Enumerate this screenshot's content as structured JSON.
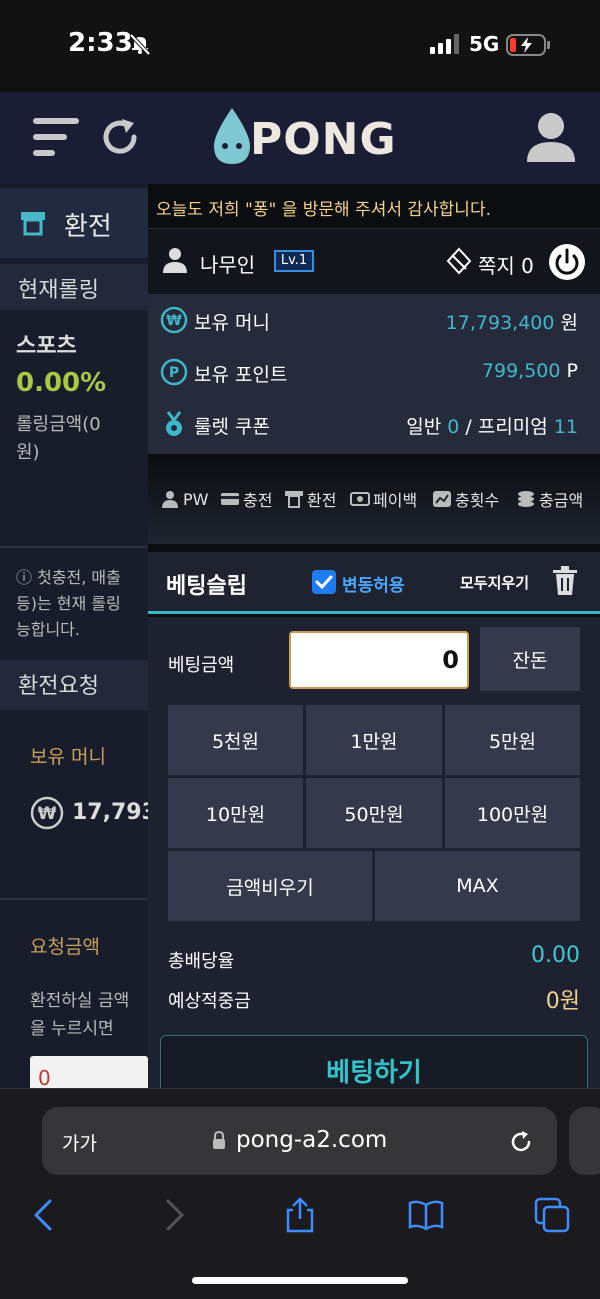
{
  "status_bar": {
    "time": "2:33",
    "network": "5G"
  },
  "header": {
    "logo_text": "PONG"
  },
  "left_page": {
    "tab_label": "환전",
    "rolling_header": "현재롤링",
    "sport_label": "스포츠",
    "sport_rate": "0.00%",
    "rolling_amount_l1": "롤링금액(0",
    "rolling_amount_l2": "원)",
    "info_l1": "ⓘ 첫충전, 매출",
    "info_l2": "등)는 현재 롤링",
    "info_l3": "능합니다.",
    "exchange_request": "환전요청",
    "money_label": "보유 머니",
    "money_value": "17,793",
    "request_amount": "요청금액",
    "request_desc_l1": "환전하실 금액",
    "request_desc_l2": "을 누르시면 ",
    "request_input": "0"
  },
  "popup": {
    "notice": "오늘도 저희 \"퐁\" 을 방문해 주셔서 감사합니다.",
    "user": {
      "name": "나무인",
      "level": "Lv.1",
      "note_label": "쪽지",
      "note_count": "0"
    },
    "wallet": {
      "money_label": "보유 머니",
      "money_value": "17,793,400",
      "money_unit": "원",
      "point_label": "보유 포인트",
      "point_value": "799,500",
      "point_unit": "P",
      "coupon_label": "룰렛 쿠폰",
      "coupon_normal_label": "일반",
      "coupon_normal": "0",
      "coupon_sep": "/",
      "coupon_premium_label": "프리미엄",
      "coupon_premium": "11"
    },
    "actions": [
      "PW",
      "충전",
      "환전",
      "페이백",
      "충횟수",
      "충금액"
    ]
  },
  "slip": {
    "title": "베팅슬립",
    "allow_change": "변동허용",
    "clear_all": "모두지우기",
    "amount_label": "베팅금액",
    "amount_value": "0",
    "change_btn": "잔돈",
    "quick": [
      "5천원",
      "1만원",
      "5만원",
      "10만원",
      "50만원",
      "100만원"
    ],
    "clear_amount": "금액비우기",
    "max": "MAX",
    "total_odds_label": "총배당율",
    "total_odds": "0.00",
    "expected_label": "예상적중금",
    "expected": "0원",
    "bet_button": "베팅하기"
  },
  "safari": {
    "aa": "가가",
    "url": "pong-a2.com"
  },
  "colors": {
    "accent": "#40b7c8",
    "notice": "#f3d38a",
    "check": "#1d7cf2",
    "header_bg": "#1a1d33"
  }
}
